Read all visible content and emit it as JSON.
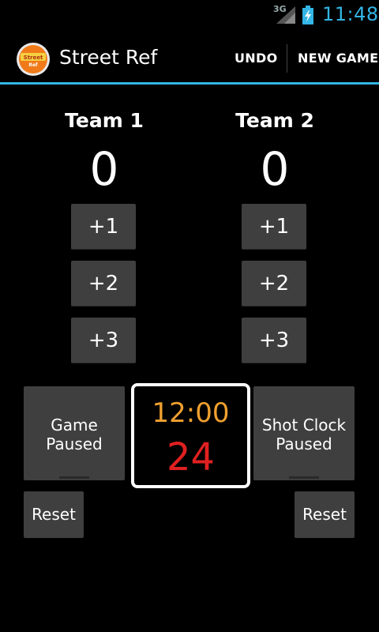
{
  "status_bar": {
    "network": "3G",
    "time": "11:48"
  },
  "action_bar": {
    "title": "Street Ref",
    "logo_text": "Street Ref",
    "undo": "UNDO",
    "new_game": "NEW GAME"
  },
  "teams": [
    {
      "name": "Team 1",
      "score": "0",
      "buttons": [
        "+1",
        "+2",
        "+3"
      ]
    },
    {
      "name": "Team 2",
      "score": "0",
      "buttons": [
        "+1",
        "+2",
        "+3"
      ]
    }
  ],
  "game_clock": {
    "button_label_1": "Game",
    "button_label_2": "Paused",
    "time": "12:00",
    "reset": "Reset"
  },
  "shot_clock": {
    "button_label_1": "Shot Clock",
    "button_label_2": "Paused",
    "time": "24",
    "reset": "Reset"
  },
  "colors": {
    "accent": "#33b5e5",
    "game_time": "#f0a030",
    "shot_time": "#e02020",
    "button": "#3f3f3f"
  }
}
